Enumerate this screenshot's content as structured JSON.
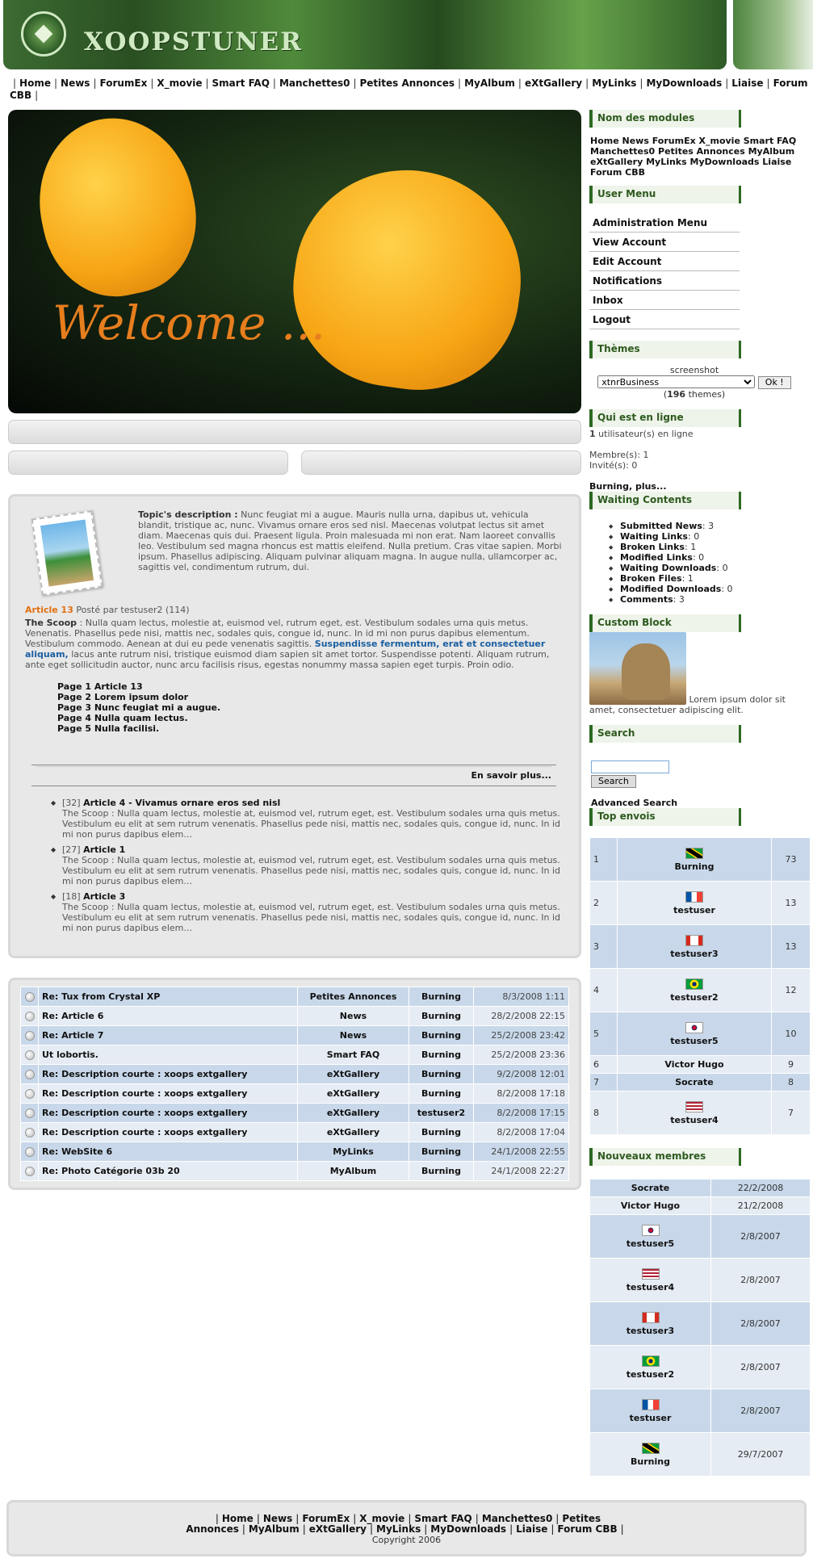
{
  "header": {
    "site_name": "XOOPSTUNER"
  },
  "nav": [
    "Home",
    "News",
    "ForumEx",
    "X_movie",
    "Smart FAQ",
    "Manchettes0",
    "Petites Annonces",
    "MyAlbum",
    "eXtGallery",
    "MyLinks",
    "MyDownloads",
    "Liaise",
    "Forum CBB"
  ],
  "hero": {
    "welcome_text": "Welcome ..."
  },
  "topic": {
    "label": "Topic's description :",
    "text": "Nunc feugiat mi a augue. Mauris nulla urna, dapibus ut, vehicula blandit, tristique ac, nunc. Vivamus ornare eros sed nisl. Maecenas volutpat lectus sit amet diam. Maecenas quis dui. Praesent ligula. Proin malesuada mi non erat. Nam laoreet convallis leo. Vestibulum sed magna rhoncus est mattis eleifend. Nulla pretium. Cras vitae sapien. Morbi ipsum. Phasellus adipiscing. Aliquam pulvinar aliquam magna. In augue nulla, ullamcorper ac, sagittis vel, condimentum rutrum, dui."
  },
  "article": {
    "title": "Article 13",
    "posted_by": "Posté par testuser2 (114)",
    "scoop_label": "The Scoop",
    "scoop_text1": ": Nulla quam lectus, molestie at, euismod vel, rutrum eget, est. Vestibulum sodales urna quis metus. Venenatis. Phasellus pede nisi, mattis nec, sodales quis, congue id, nunc. In id mi non purus dapibus elementum. Vestibulum commodo. Aenean at dui eu pede venenatis sagittis.",
    "scoop_link": "Suspendisse fermentum, erat et consectetuer aliquam,",
    "scoop_text2": "lacus ante rutrum nisi, tristique euismod diam sapien sit amet tortor. Suspendisse potenti. Aliquam rutrum, ante eget sollicitudin auctor, nunc arcu facilisis risus, egestas nonummy massa sapien eget turpis. Proin odio.",
    "pages": [
      "Page 1 Article 13",
      "Page 2 Lorem ipsum dolor",
      "Page 3 Nunc feugiat mi a augue.",
      "Page 4 Nulla quam lectus.",
      "Page 5 Nulla facilisi."
    ],
    "read_more": "En savoir plus..."
  },
  "article_list": [
    {
      "count": "[32]",
      "title": "Article 4 - Vivamus ornare eros sed nisl",
      "text": "The Scoop : Nulla quam lectus, molestie at, euismod vel, rutrum eget, est. Vestibulum sodales urna quis metus. Vestibulum eu elit at sem rutrum venenatis. Phasellus pede nisi, mattis nec, sodales quis, congue id, nunc. In id mi non purus dapibus elem..."
    },
    {
      "count": "[27]",
      "title": "Article 1",
      "text": "The Scoop : Nulla quam lectus, molestie at, euismod vel, rutrum eget, est. Vestibulum sodales urna quis metus. Vestibulum eu elit at sem rutrum venenatis. Phasellus pede nisi, mattis nec, sodales quis, congue id, nunc. In id mi non purus dapibus elem..."
    },
    {
      "count": "[18]",
      "title": "Article 3",
      "text": "The Scoop : Nulla quam lectus, molestie at, euismod vel, rutrum eget, est. Vestibulum sodales urna quis metus. Vestibulum eu elit at sem rutrum venenatis. Phasellus pede nisi, mattis nec, sodales quis, congue id, nunc. In id mi non purus dapibus elem..."
    }
  ],
  "forum_posts": [
    {
      "title": "Re: Tux from Crystal XP",
      "module": "Petites Annonces",
      "user": "Burning",
      "date": "8/3/2008 1:11"
    },
    {
      "title": "Re: Article 6",
      "module": "News",
      "user": "Burning",
      "date": "28/2/2008 22:15"
    },
    {
      "title": "Re: Article 7",
      "module": "News",
      "user": "Burning",
      "date": "25/2/2008 23:42"
    },
    {
      "title": "Ut lobortis.",
      "module": "Smart FAQ",
      "user": "Burning",
      "date": "25/2/2008 23:36"
    },
    {
      "title": "Re: Description courte : xoops extgallery",
      "module": "eXtGallery",
      "user": "Burning",
      "date": "9/2/2008 12:01"
    },
    {
      "title": "Re: Description courte : xoops extgallery",
      "module": "eXtGallery",
      "user": "Burning",
      "date": "8/2/2008 17:18"
    },
    {
      "title": "Re: Description courte : xoops extgallery",
      "module": "eXtGallery",
      "user": "testuser2",
      "date": "8/2/2008 17:15"
    },
    {
      "title": "Re: Description courte : xoops extgallery",
      "module": "eXtGallery",
      "user": "Burning",
      "date": "8/2/2008 17:04"
    },
    {
      "title": "Re: WebSite 6",
      "module": "MyLinks",
      "user": "Burning",
      "date": "24/1/2008 22:55"
    },
    {
      "title": "Re: Photo Catégorie 03b 20",
      "module": "MyAlbum",
      "user": "Burning",
      "date": "24/1/2008 22:27"
    }
  ],
  "sidebar": {
    "modules_title": "Nom des modules",
    "modules_text": "Home News ForumEx X_movie Smart FAQ Manchettes0 Petites Annonces MyAlbum eXtGallery MyLinks MyDownloads Liaise Forum CBB",
    "user_menu_title": "User Menu",
    "user_menu": [
      "Administration Menu",
      "View Account",
      "Edit Account",
      "Notifications",
      "Inbox",
      "Logout"
    ],
    "themes_title": "Thèmes",
    "themes_screenshot": "screenshot",
    "themes_selected": "xtnrBusiness",
    "themes_ok": "Ok !",
    "themes_count_num": "196",
    "themes_count_label": "themes",
    "online_title": "Qui est en ligne",
    "online_count": "1",
    "online_text": "utilisateur(s) en ligne",
    "members_line": "Membre(s): 1",
    "guests_line": "Invité(s): 0",
    "online_users": "Burning, plus...",
    "waiting_title": "Waiting Contents",
    "waiting": [
      {
        "label": "Submitted News",
        "value": "3"
      },
      {
        "label": "Waiting Links",
        "value": "0"
      },
      {
        "label": "Broken Links",
        "value": "1"
      },
      {
        "label": "Modified Links",
        "value": "0"
      },
      {
        "label": "Waiting Downloads",
        "value": "0"
      },
      {
        "label": "Broken Files",
        "value": "1"
      },
      {
        "label": "Modified Downloads",
        "value": "0"
      },
      {
        "label": "Comments",
        "value": "3"
      }
    ],
    "custom_title": "Custom Block",
    "custom_text": "Lorem ipsum dolor sit amet, consectetuer adipiscing elit.",
    "search_title": "Search",
    "search_button": "Search",
    "advanced_search": "Advanced Search",
    "top_title": "Top envois",
    "top_posters": [
      {
        "rank": "1",
        "name": "Burning",
        "posts": "73",
        "flag": "jamaica"
      },
      {
        "rank": "2",
        "name": "testuser",
        "posts": "13",
        "flag": "france"
      },
      {
        "rank": "3",
        "name": "testuser3",
        "posts": "13",
        "flag": "canada"
      },
      {
        "rank": "4",
        "name": "testuser2",
        "posts": "12",
        "flag": "brazil"
      },
      {
        "rank": "5",
        "name": "testuser5",
        "posts": "10",
        "flag": "korea"
      },
      {
        "rank": "6",
        "name": "Victor Hugo",
        "posts": "9",
        "flag": ""
      },
      {
        "rank": "7",
        "name": "Socrate",
        "posts": "8",
        "flag": ""
      },
      {
        "rank": "8",
        "name": "testuser4",
        "posts": "7",
        "flag": "usa"
      }
    ],
    "new_title": "Nouveaux membres",
    "new_members": [
      {
        "name": "Socrate",
        "date": "22/2/2008",
        "flag": ""
      },
      {
        "name": "Victor Hugo",
        "date": "21/2/2008",
        "flag": ""
      },
      {
        "name": "testuser5",
        "date": "2/8/2007",
        "flag": "korea"
      },
      {
        "name": "testuser4",
        "date": "2/8/2007",
        "flag": "usa"
      },
      {
        "name": "testuser3",
        "date": "2/8/2007",
        "flag": "canada"
      },
      {
        "name": "testuser2",
        "date": "2/8/2007",
        "flag": "brazil"
      },
      {
        "name": "testuser",
        "date": "2/8/2007",
        "flag": "france"
      },
      {
        "name": "Burning",
        "date": "29/7/2007",
        "flag": "jamaica"
      }
    ]
  },
  "footer": {
    "copyright": "Copyright 2006"
  }
}
